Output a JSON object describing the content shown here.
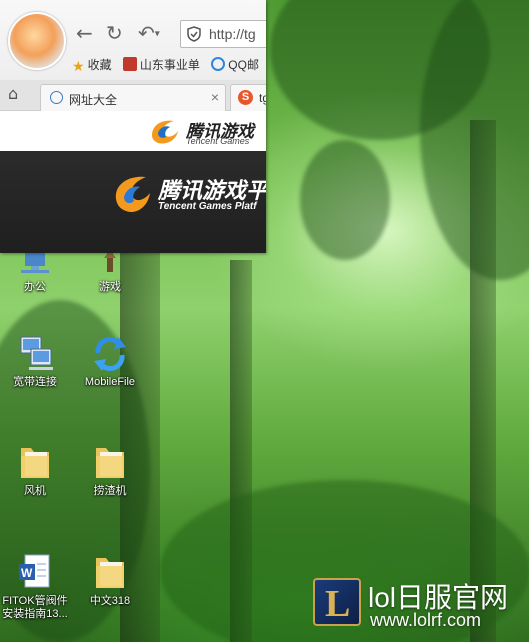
{
  "browser": {
    "address": "http://tg",
    "bookmarks": [
      {
        "label": "收藏"
      },
      {
        "label": "山东事业单"
      },
      {
        "label": "QQ邮"
      }
    ],
    "tabs": [
      {
        "label": "网址大全"
      },
      {
        "label": "tg"
      }
    ],
    "page_logo_text": "腾讯游戏",
    "page_logo_sub": "Tencent Games",
    "banner_title": "腾讯游戏平",
    "banner_sub": "Tencent Games Platf"
  },
  "desktop_icons": [
    {
      "label": "办公",
      "icon": "network-folder-icon"
    },
    {
      "label": "游戏",
      "icon": "game-icon"
    },
    {
      "label": "宽带连接",
      "icon": "broadband-connection-icon"
    },
    {
      "label": "MobileFile",
      "icon": "mobilefile-sync-icon"
    },
    {
      "label": "风机",
      "icon": "folder-icon"
    },
    {
      "label": "捞渣机",
      "icon": "folder-icon"
    },
    {
      "label": "FITOK管阀件",
      "label2": "安装指南13...",
      "icon": "word-document-icon"
    },
    {
      "label": "中文318",
      "icon": "folder-icon"
    }
  ],
  "watermark": {
    "title": "lol日服官网",
    "url": "www.lolrf.com",
    "logo_letter": "L"
  },
  "colors": {
    "accent_blue": "#3a78c8",
    "tencent_orange": "#f39a1e",
    "forest_green": "#78c052"
  }
}
